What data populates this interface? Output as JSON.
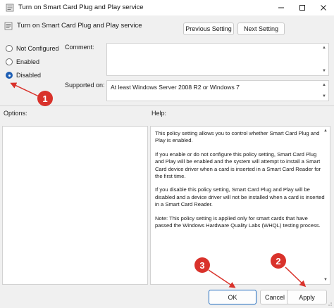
{
  "window": {
    "title": "Turn on Smart Card Plug and Play service",
    "controls": [
      "minimize-icon",
      "maximize-icon",
      "close-icon"
    ]
  },
  "header": {
    "policy_name": "Turn on Smart Card Plug and Play service",
    "previous_label": "Previous Setting",
    "next_label": "Next Setting"
  },
  "state": {
    "options": [
      {
        "label": "Not Configured",
        "checked": false
      },
      {
        "label": "Enabled",
        "checked": false
      },
      {
        "label": "Disabled",
        "checked": true
      }
    ]
  },
  "comment": {
    "label": "Comment:",
    "value": ""
  },
  "supported": {
    "label": "Supported on:",
    "value": "At least Windows Server 2008 R2 or Windows 7"
  },
  "options_panel": {
    "label": "Options:"
  },
  "help_panel": {
    "label": "Help:",
    "paragraphs": [
      "This policy setting allows you to control whether Smart Card Plug and Play is enabled.",
      "If you enable or do not configure this policy setting, Smart Card Plug and Play will be enabled and the system will attempt to install a Smart Card device driver when a card is inserted in a Smart Card Reader for the first time.",
      "If you disable this policy setting, Smart Card Plug and Play will be disabled and a device driver will not be installed when a card is inserted in a Smart Card Reader.",
      "Note: This policy setting is applied only for smart cards that have passed the Windows Hardware Quality Labs (WHQL) testing process."
    ]
  },
  "footer": {
    "ok_label": "OK",
    "cancel_label": "Cancel",
    "apply_label": "Apply"
  },
  "annotations": {
    "badge_1": "1",
    "badge_2": "2",
    "badge_3": "3",
    "color": "#d9322b"
  }
}
